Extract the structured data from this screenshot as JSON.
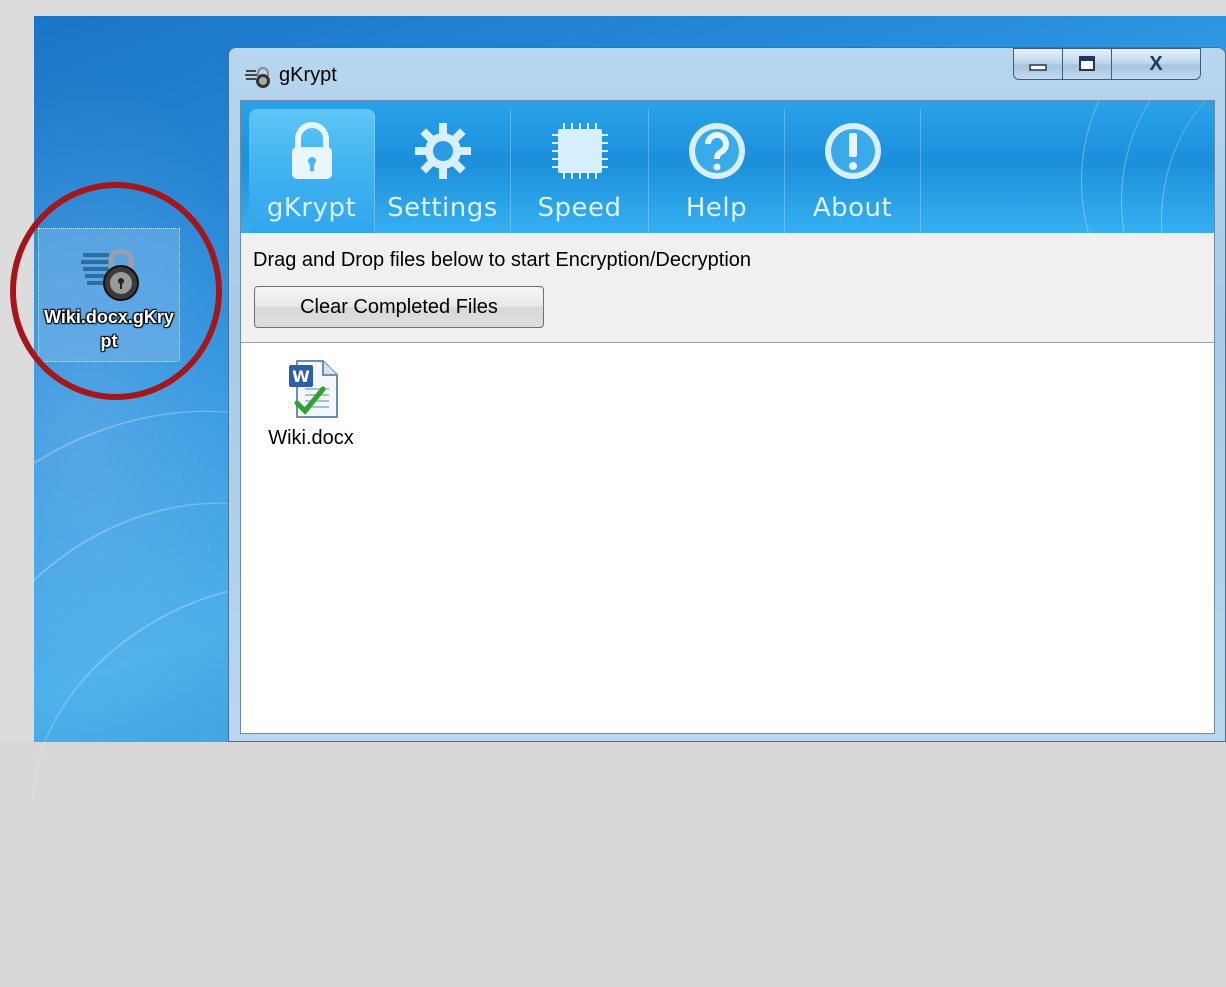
{
  "desktop": {
    "icon": {
      "label": "Wiki.docx.gKrypt",
      "icon": "lock-file-icon"
    },
    "highlight_color": "#a5161a"
  },
  "window": {
    "title": "gKrypt",
    "caption_buttons": {
      "minimize": "minimize",
      "maximize": "maximize",
      "close": "X"
    },
    "tabs": [
      {
        "label": "gKrypt",
        "icon": "padlock-icon",
        "active": true
      },
      {
        "label": "Settings",
        "icon": "gear-icon",
        "active": false
      },
      {
        "label": "Speed",
        "icon": "chip-icon",
        "active": false
      },
      {
        "label": "Help",
        "icon": "question-icon",
        "active": false
      },
      {
        "label": "About",
        "icon": "exclamation-icon",
        "active": false
      }
    ],
    "instructions": "Drag and Drop files below to start Encryption/Decryption",
    "clear_button": "Clear Completed Files",
    "files": [
      {
        "name": "Wiki.docx",
        "icon": "word-document-check-icon"
      }
    ]
  },
  "colors": {
    "tab_bar": "#1b8fdb",
    "tab_active": "#3fb2ef",
    "panel": "#f0f0f0"
  }
}
